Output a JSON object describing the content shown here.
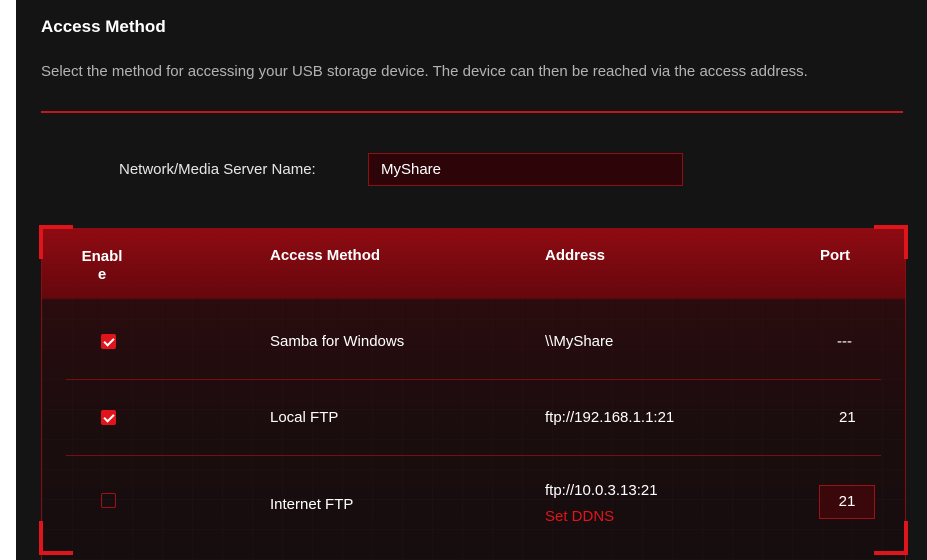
{
  "section": {
    "title": "Access Method",
    "description": "Select the method for accessing your USB storage device. The device can then be reached via the access address."
  },
  "server_name": {
    "label": "Network/Media Server Name:",
    "value": "MyShare"
  },
  "table": {
    "headers": {
      "enable_line1": "Enabl",
      "enable_line2": "e",
      "method": "Access Method",
      "address": "Address",
      "port": "Port"
    },
    "rows": [
      {
        "enabled": true,
        "method": "Samba for Windows",
        "address": "\\\\MyShare",
        "port": "---"
      },
      {
        "enabled": true,
        "method": "Local FTP",
        "address": "ftp://192.168.1.1:21",
        "port": "21"
      },
      {
        "enabled": false,
        "method": "Internet FTP",
        "address": "ftp://10.0.3.13:21",
        "link": "Set DDNS",
        "port": "21"
      }
    ]
  },
  "colors": {
    "accent": "#e0141b",
    "background": "#141414"
  }
}
